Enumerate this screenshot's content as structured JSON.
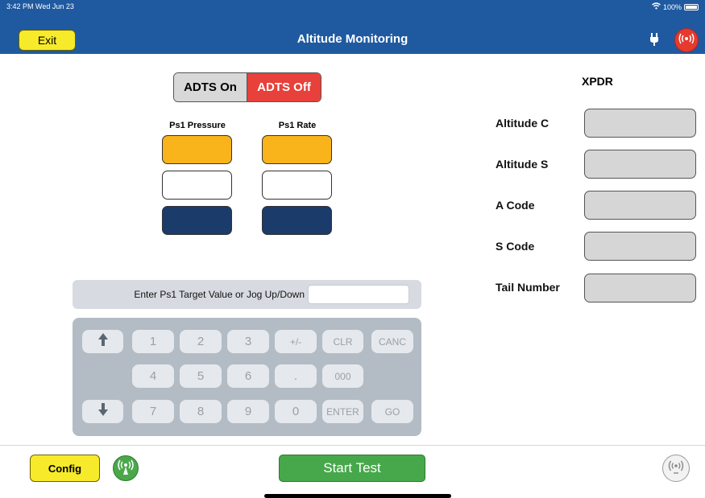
{
  "status_bar": {
    "time": "3:42 PM  Wed Jun 23",
    "battery": "100%"
  },
  "nav": {
    "exit_label": "Exit",
    "title": "Altitude Monitoring"
  },
  "adts": {
    "on_label": "ADTS On",
    "off_label": "ADTS Off",
    "selected": "ADTS Off"
  },
  "ps1": {
    "pressure_header": "Ps1 Pressure",
    "rate_header": "Ps1 Rate"
  },
  "entry": {
    "label": "Enter Ps1 Target Value or Jog Up/Down",
    "value": ""
  },
  "keypad": {
    "row1": [
      "1",
      "2",
      "3",
      "+/-",
      "CLR",
      "CANC"
    ],
    "row2": [
      "4",
      "5",
      "6",
      ".",
      "000"
    ],
    "row3": [
      "7",
      "8",
      "9",
      "0",
      "ENTER",
      "GO"
    ]
  },
  "xpdr": {
    "title": "XPDR",
    "fields": [
      {
        "label": "Altitude C",
        "value": ""
      },
      {
        "label": "Altitude S",
        "value": ""
      },
      {
        "label": "A Code",
        "value": ""
      },
      {
        "label": "S Code",
        "value": ""
      },
      {
        "label": "Tail Number",
        "value": ""
      }
    ]
  },
  "bottom": {
    "config_label": "Config",
    "start_label": "Start Test"
  },
  "colors": {
    "nav_blue": "#1f5aa0",
    "yellow": "#f7ea2a",
    "red": "#e8403a",
    "orange": "#f9b31b",
    "navy": "#1b3b6a",
    "green": "#46a84a"
  },
  "icons": {
    "plug": "plug-icon",
    "alarm": "alarm-broadcast-icon",
    "signal": "antenna-signal-icon",
    "wireless": "wireless-icon",
    "up": "arrow-up-icon",
    "down": "arrow-down-icon"
  }
}
